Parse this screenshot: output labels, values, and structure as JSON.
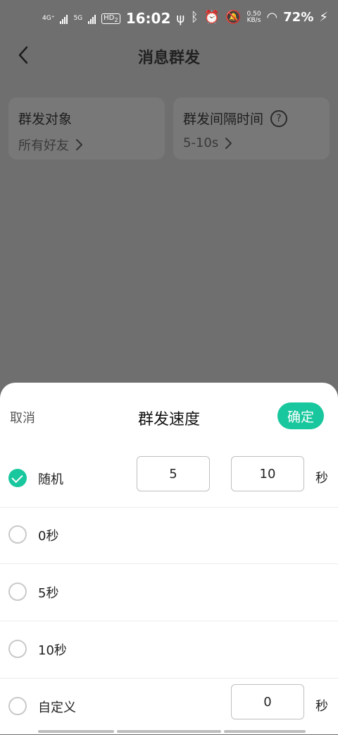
{
  "status_bar": {
    "net1": "4G⁺",
    "net2": "5G",
    "hd": "HD",
    "hd_sub": "2",
    "time": "16:02",
    "speed_value": "0.50",
    "speed_unit": "KB/s",
    "battery": "72%"
  },
  "header": {
    "title": "消息群发"
  },
  "cards": {
    "target_label": "群发对象",
    "target_value": "所有好友",
    "interval_label": "群发间隔时间",
    "interval_value": "5-10s"
  },
  "sheet": {
    "cancel": "取消",
    "title": "群发速度",
    "confirm": "确定",
    "options": [
      {
        "label": "随机",
        "selected": true,
        "min": "5",
        "max": "10",
        "unit": "秒"
      },
      {
        "label": "0秒",
        "selected": false
      },
      {
        "label": "5秒",
        "selected": false
      },
      {
        "label": "10秒",
        "selected": false
      },
      {
        "label": "自定义",
        "selected": false,
        "value": "0",
        "unit": "秒"
      }
    ]
  },
  "colors": {
    "accent": "#18c79d",
    "overlay": "#6f6f6f"
  }
}
